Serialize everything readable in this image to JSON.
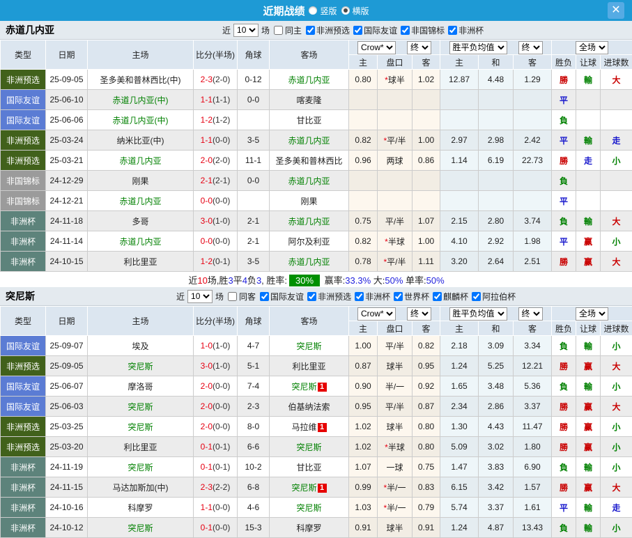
{
  "topbar": {
    "title": "近期战绩",
    "radios": [
      {
        "label": "竖版",
        "selected": false
      },
      {
        "label": "横版",
        "selected": true
      }
    ],
    "close_label": "✕"
  },
  "filter_words": {
    "near": "近",
    "count": "10",
    "games": "场"
  },
  "columns": {
    "type": "类型",
    "date": "日期",
    "home": "主场",
    "score": "比分(半场)",
    "corner": "角球",
    "away": "客场",
    "odds_home": "主",
    "odds_handicap": "盘口",
    "odds_away": "客",
    "avg_home": "主",
    "avg_draw": "和",
    "avg_away": "客",
    "result": "胜负",
    "handicap_result": "让球",
    "goals": "进球数"
  },
  "selects": {
    "bookmaker": "Crow*",
    "final": "终",
    "avg": "胜平负均值",
    "scope": "全场"
  },
  "type_colors": {
    "非洲预选": "#41611b",
    "国际友谊": "#5b7cd4",
    "非国锦标": "#9b9b9b",
    "非洲杯": "#5d837b"
  },
  "result_colors": {
    "r": "#c90000",
    "b": "#1515cc",
    "g": "#008000"
  },
  "sections": [
    {
      "team": "赤道几内亚",
      "same_label": "同主",
      "same_checked": false,
      "leagues": [
        {
          "label": "非洲预选",
          "checked": true
        },
        {
          "label": "国际友谊",
          "checked": true
        },
        {
          "label": "非国锦标",
          "checked": true
        },
        {
          "label": "非洲杯",
          "checked": true
        }
      ],
      "rows": [
        {
          "type": "非洲预选",
          "date": "25-09-05",
          "home": "圣多美和普林西比(中)",
          "home_green": false,
          "home_badge": "",
          "score": "2-3",
          "half": "(2-0)",
          "corner": "0-12",
          "away": "赤道几内亚",
          "away_green": true,
          "away_badge": "",
          "o_home": "0.80",
          "handicap": "*球半",
          "o_away": "1.02",
          "avg_home": "12.87",
          "avg_draw": "4.48",
          "avg_away": "1.29",
          "res": "勝",
          "res_c": "r",
          "let": "輸",
          "let_c": "g",
          "goal": "大",
          "goal_c": "r"
        },
        {
          "type": "国际友谊",
          "date": "25-06-10",
          "home": "赤道几内亚(中)",
          "home_green": true,
          "home_badge": "",
          "score": "1-1",
          "half": "(1-1)",
          "corner": "0-0",
          "away": "喀麦隆",
          "away_green": false,
          "away_badge": "",
          "o_home": "",
          "handicap": "",
          "o_away": "",
          "avg_home": "",
          "avg_draw": "",
          "avg_away": "",
          "res": "平",
          "res_c": "b",
          "let": "",
          "let_c": "",
          "goal": "",
          "goal_c": ""
        },
        {
          "type": "国际友谊",
          "date": "25-06-06",
          "home": "赤道几内亚(中)",
          "home_green": true,
          "home_badge": "",
          "score": "1-2",
          "half": "(1-2)",
          "corner": "",
          "away": "甘比亚",
          "away_green": false,
          "away_badge": "",
          "o_home": "",
          "handicap": "",
          "o_away": "",
          "avg_home": "",
          "avg_draw": "",
          "avg_away": "",
          "res": "負",
          "res_c": "g",
          "let": "",
          "let_c": "",
          "goal": "",
          "goal_c": ""
        },
        {
          "type": "非洲预选",
          "date": "25-03-24",
          "home": "纳米比亚(中)",
          "home_green": false,
          "home_badge": "",
          "score": "1-1",
          "half": "(0-0)",
          "corner": "3-5",
          "away": "赤道几内亚",
          "away_green": true,
          "away_badge": "",
          "o_home": "0.82",
          "handicap": "*平/半",
          "o_away": "1.00",
          "avg_home": "2.97",
          "avg_draw": "2.98",
          "avg_away": "2.42",
          "res": "平",
          "res_c": "b",
          "let": "輸",
          "let_c": "g",
          "goal": "走",
          "goal_c": "b"
        },
        {
          "type": "非洲预选",
          "date": "25-03-21",
          "home": "赤道几内亚",
          "home_green": true,
          "home_badge": "",
          "score": "2-0",
          "half": "(2-0)",
          "corner": "11-1",
          "away": "圣多美和普林西比",
          "away_green": false,
          "away_badge": "",
          "o_home": "0.96",
          "handicap": "两球",
          "o_away": "0.86",
          "avg_home": "1.14",
          "avg_draw": "6.19",
          "avg_away": "22.73",
          "res": "勝",
          "res_c": "r",
          "let": "走",
          "let_c": "b",
          "goal": "小",
          "goal_c": "g"
        },
        {
          "type": "非国锦标",
          "date": "24-12-29",
          "home": "刚果",
          "home_green": false,
          "home_badge": "",
          "score": "2-1",
          "half": "(2-1)",
          "corner": "0-0",
          "away": "赤道几内亚",
          "away_green": true,
          "away_badge": "",
          "o_home": "",
          "handicap": "",
          "o_away": "",
          "avg_home": "",
          "avg_draw": "",
          "avg_away": "",
          "res": "負",
          "res_c": "g",
          "let": "",
          "let_c": "",
          "goal": "",
          "goal_c": ""
        },
        {
          "type": "非国锦标",
          "date": "24-12-21",
          "home": "赤道几内亚",
          "home_green": true,
          "home_badge": "",
          "score": "0-0",
          "half": "(0-0)",
          "corner": "",
          "away": "刚果",
          "away_green": false,
          "away_badge": "",
          "o_home": "",
          "handicap": "",
          "o_away": "",
          "avg_home": "",
          "avg_draw": "",
          "avg_away": "",
          "res": "平",
          "res_c": "b",
          "let": "",
          "let_c": "",
          "goal": "",
          "goal_c": ""
        },
        {
          "type": "非洲杯",
          "date": "24-11-18",
          "home": "多哥",
          "home_green": false,
          "home_badge": "",
          "score": "3-0",
          "half": "(1-0)",
          "corner": "2-1",
          "away": "赤道几内亚",
          "away_green": true,
          "away_badge": "",
          "o_home": "0.75",
          "handicap": "平/半",
          "o_away": "1.07",
          "avg_home": "2.15",
          "avg_draw": "2.80",
          "avg_away": "3.74",
          "res": "負",
          "res_c": "g",
          "let": "輸",
          "let_c": "g",
          "goal": "大",
          "goal_c": "r"
        },
        {
          "type": "非洲杯",
          "date": "24-11-14",
          "home": "赤道几内亚",
          "home_green": true,
          "home_badge": "",
          "score": "0-0",
          "half": "(0-0)",
          "corner": "2-1",
          "away": "阿尔及利亚",
          "away_green": false,
          "away_badge": "",
          "o_home": "0.82",
          "handicap": "*半球",
          "o_away": "1.00",
          "avg_home": "4.10",
          "avg_draw": "2.92",
          "avg_away": "1.98",
          "res": "平",
          "res_c": "b",
          "let": "赢",
          "let_c": "r",
          "goal": "小",
          "goal_c": "g"
        },
        {
          "type": "非洲杯",
          "date": "24-10-15",
          "home": "利比里亚",
          "home_green": false,
          "home_badge": "",
          "score": "1-2",
          "half": "(0-1)",
          "corner": "3-5",
          "away": "赤道几内亚",
          "away_green": true,
          "away_badge": "",
          "o_home": "0.78",
          "handicap": "*平/半",
          "o_away": "1.11",
          "avg_home": "3.20",
          "avg_draw": "2.64",
          "avg_away": "2.51",
          "res": "勝",
          "res_c": "r",
          "let": "赢",
          "let_c": "r",
          "goal": "大",
          "goal_c": "r"
        }
      ],
      "summary": [
        {
          "t": "近"
        },
        {
          "t": "10",
          "c": "red"
        },
        {
          "t": "场,胜"
        },
        {
          "t": "3",
          "c": "blue"
        },
        {
          "t": "平"
        },
        {
          "t": "4",
          "c": "blue"
        },
        {
          "t": "负"
        },
        {
          "t": "3",
          "c": "blue"
        },
        {
          "t": ", 胜率:"
        },
        {
          "t": "30%",
          "badge": true
        },
        {
          "t": " 赢率:"
        },
        {
          "t": "33.3%",
          "c": "blue"
        },
        {
          "t": " 大:"
        },
        {
          "t": "50%",
          "c": "blue"
        },
        {
          "t": " 单率:"
        },
        {
          "t": "50%",
          "c": "blue"
        }
      ]
    },
    {
      "team": "突尼斯",
      "same_label": "同客",
      "same_checked": false,
      "leagues": [
        {
          "label": "国际友谊",
          "checked": true
        },
        {
          "label": "非洲预选",
          "checked": true
        },
        {
          "label": "非洲杯",
          "checked": true
        },
        {
          "label": "世界杯",
          "checked": true
        },
        {
          "label": "麒麟杯",
          "checked": true
        },
        {
          "label": "阿拉伯杯",
          "checked": true
        }
      ],
      "rows": [
        {
          "type": "国际友谊",
          "date": "25-09-07",
          "home": "埃及",
          "home_green": false,
          "home_badge": "",
          "score": "1-0",
          "half": "(1-0)",
          "corner": "4-7",
          "away": "突尼斯",
          "away_green": true,
          "away_badge": "",
          "o_home": "1.00",
          "handicap": "平/半",
          "o_away": "0.82",
          "avg_home": "2.18",
          "avg_draw": "3.09",
          "avg_away": "3.34",
          "res": "負",
          "res_c": "g",
          "let": "輸",
          "let_c": "g",
          "goal": "小",
          "goal_c": "g"
        },
        {
          "type": "非洲预选",
          "date": "25-09-05",
          "home": "突尼斯",
          "home_green": true,
          "home_badge": "",
          "score": "3-0",
          "half": "(1-0)",
          "corner": "5-1",
          "away": "利比里亚",
          "away_green": false,
          "away_badge": "",
          "o_home": "0.87",
          "handicap": "球半",
          "o_away": "0.95",
          "avg_home": "1.24",
          "avg_draw": "5.25",
          "avg_away": "12.21",
          "res": "勝",
          "res_c": "r",
          "let": "赢",
          "let_c": "r",
          "goal": "大",
          "goal_c": "r"
        },
        {
          "type": "国际友谊",
          "date": "25-06-07",
          "home": "摩洛哥",
          "home_green": false,
          "home_badge": "",
          "score": "2-0",
          "half": "(0-0)",
          "corner": "7-4",
          "away": "突尼斯",
          "away_green": true,
          "away_badge": "1",
          "o_home": "0.90",
          "handicap": "半/一",
          "o_away": "0.92",
          "avg_home": "1.65",
          "avg_draw": "3.48",
          "avg_away": "5.36",
          "res": "負",
          "res_c": "g",
          "let": "輸",
          "let_c": "g",
          "goal": "小",
          "goal_c": "g"
        },
        {
          "type": "国际友谊",
          "date": "25-06-03",
          "home": "突尼斯",
          "home_green": true,
          "home_badge": "",
          "score": "2-0",
          "half": "(0-0)",
          "corner": "2-3",
          "away": "伯基纳法索",
          "away_green": false,
          "away_badge": "",
          "o_home": "0.95",
          "handicap": "平/半",
          "o_away": "0.87",
          "avg_home": "2.34",
          "avg_draw": "2.86",
          "avg_away": "3.37",
          "res": "勝",
          "res_c": "r",
          "let": "赢",
          "let_c": "r",
          "goal": "大",
          "goal_c": "r"
        },
        {
          "type": "非洲预选",
          "date": "25-03-25",
          "home": "突尼斯",
          "home_green": true,
          "home_badge": "",
          "score": "2-0",
          "half": "(0-0)",
          "corner": "8-0",
          "away": "马拉维",
          "away_green": false,
          "away_badge": "1",
          "o_home": "1.02",
          "handicap": "球半",
          "o_away": "0.80",
          "avg_home": "1.30",
          "avg_draw": "4.43",
          "avg_away": "11.47",
          "res": "勝",
          "res_c": "r",
          "let": "赢",
          "let_c": "r",
          "goal": "小",
          "goal_c": "g"
        },
        {
          "type": "非洲预选",
          "date": "25-03-20",
          "home": "利比里亚",
          "home_green": false,
          "home_badge": "",
          "score": "0-1",
          "half": "(0-1)",
          "corner": "6-6",
          "away": "突尼斯",
          "away_green": true,
          "away_badge": "",
          "o_home": "1.02",
          "handicap": "*半球",
          "o_away": "0.80",
          "avg_home": "5.09",
          "avg_draw": "3.02",
          "avg_away": "1.80",
          "res": "勝",
          "res_c": "r",
          "let": "赢",
          "let_c": "r",
          "goal": "小",
          "goal_c": "g"
        },
        {
          "type": "非洲杯",
          "date": "24-11-19",
          "home": "突尼斯",
          "home_green": true,
          "home_badge": "",
          "score": "0-1",
          "half": "(0-1)",
          "corner": "10-2",
          "away": "甘比亚",
          "away_green": false,
          "away_badge": "",
          "o_home": "1.07",
          "handicap": "一球",
          "o_away": "0.75",
          "avg_home": "1.47",
          "avg_draw": "3.83",
          "avg_away": "6.90",
          "res": "負",
          "res_c": "g",
          "let": "輸",
          "let_c": "g",
          "goal": "小",
          "goal_c": "g"
        },
        {
          "type": "非洲杯",
          "date": "24-11-15",
          "home": "马达加斯加(中)",
          "home_green": false,
          "home_badge": "",
          "score": "2-3",
          "half": "(2-2)",
          "corner": "6-8",
          "away": "突尼斯",
          "away_green": true,
          "away_badge": "1",
          "o_home": "0.99",
          "handicap": "*半/一",
          "o_away": "0.83",
          "avg_home": "6.15",
          "avg_draw": "3.42",
          "avg_away": "1.57",
          "res": "勝",
          "res_c": "r",
          "let": "赢",
          "let_c": "r",
          "goal": "大",
          "goal_c": "r"
        },
        {
          "type": "非洲杯",
          "date": "24-10-16",
          "home": "科摩罗",
          "home_green": false,
          "home_badge": "",
          "score": "1-1",
          "half": "(0-0)",
          "corner": "4-6",
          "away": "突尼斯",
          "away_green": true,
          "away_badge": "",
          "o_home": "1.03",
          "handicap": "*半/一",
          "o_away": "0.79",
          "avg_home": "5.74",
          "avg_draw": "3.37",
          "avg_away": "1.61",
          "res": "平",
          "res_c": "b",
          "let": "輸",
          "let_c": "g",
          "goal": "走",
          "goal_c": "b"
        },
        {
          "type": "非洲杯",
          "date": "24-10-12",
          "home": "突尼斯",
          "home_green": true,
          "home_badge": "",
          "score": "0-1",
          "half": "(0-0)",
          "corner": "15-3",
          "away": "科摩罗",
          "away_green": false,
          "away_badge": "",
          "o_home": "0.91",
          "handicap": "球半",
          "o_away": "0.91",
          "avg_home": "1.24",
          "avg_draw": "4.87",
          "avg_away": "13.43",
          "res": "負",
          "res_c": "g",
          "let": "輸",
          "let_c": "g",
          "goal": "小",
          "goal_c": "g"
        }
      ],
      "summary": []
    }
  ]
}
